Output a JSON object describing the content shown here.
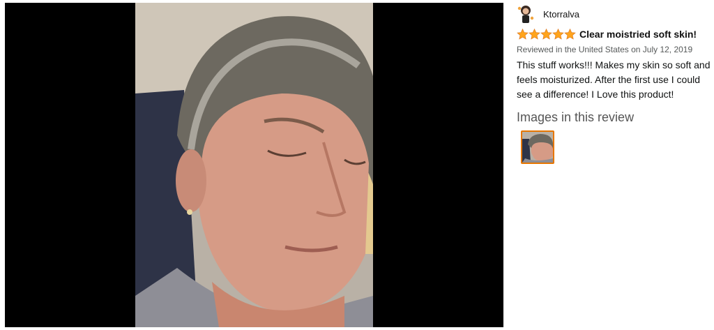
{
  "review": {
    "author": "Ktorralva",
    "rating": 5,
    "rating_max": 5,
    "title": "Clear moistried soft skin!",
    "meta": "Reviewed in the United States on July 12, 2019",
    "body": "This stuff works!!! Makes my skin so soft and feels moisturized. After the first use I could see a difference! I Love this product!",
    "images_heading": "Images in this review"
  },
  "colors": {
    "viewer_background": "#000000",
    "star": "#ffa41c",
    "thumb_border": "#e77600"
  },
  "icons": {
    "avatar": "avatar-icon",
    "star": "star-icon"
  }
}
